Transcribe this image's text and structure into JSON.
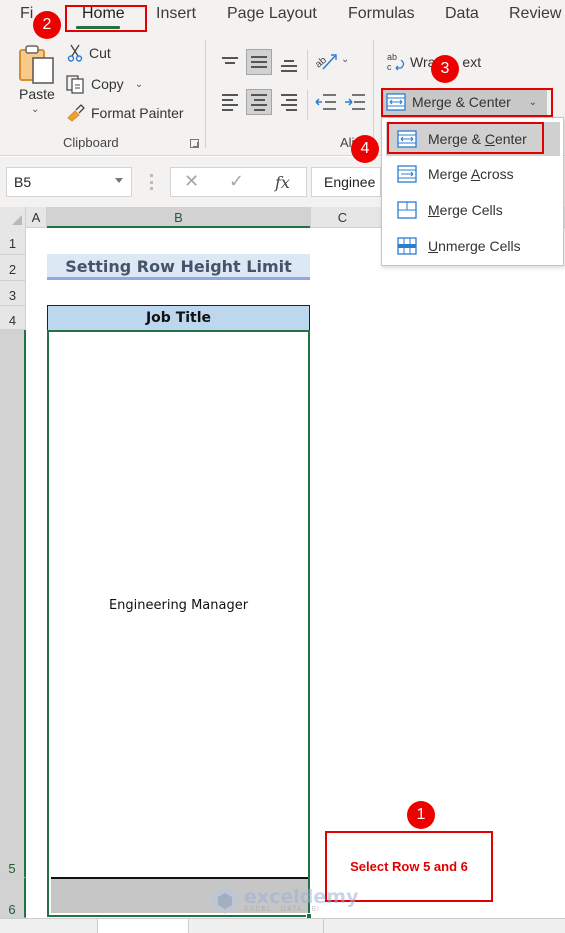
{
  "ribbon": {
    "tabs": [
      {
        "label": "File",
        "visible_text": "Fi"
      },
      {
        "label": "Home",
        "active": true
      },
      {
        "label": "Insert"
      },
      {
        "label": "Page Layout"
      },
      {
        "label": "Formulas"
      },
      {
        "label": "Data"
      },
      {
        "label": "Review"
      }
    ],
    "clipboard": {
      "paste_label": "Paste",
      "cut_label": "Cut",
      "copy_label": "Copy",
      "format_painter_label": "Format Painter",
      "group_label": "Clipboard"
    },
    "alignment": {
      "group_label": "Ali",
      "wrap_text_label": "Wrap Text",
      "wrap_text_visible": [
        "Wra",
        "ext"
      ],
      "merge_center_label": "Merge & Center"
    }
  },
  "merge_menu": {
    "items": [
      {
        "label_pre": "Merge & ",
        "accel": "C",
        "label_post": "enter",
        "icon": "merge-center-icon",
        "selected": true
      },
      {
        "label_pre": "Merge ",
        "accel": "A",
        "label_post": "cross",
        "icon": "merge-across-icon",
        "selected": false
      },
      {
        "label_pre": "",
        "accel": "M",
        "label_post": "erge Cells",
        "icon": "merge-cells-icon",
        "selected": false
      },
      {
        "label_pre": "",
        "accel": "U",
        "label_post": "nmerge Cells",
        "icon": "unmerge-cells-icon",
        "selected": false
      }
    ]
  },
  "formula_bar": {
    "name_box": "B5",
    "cancel_icon": "✕",
    "enter_icon": "✓",
    "fx_label": "fx",
    "content": "Engineering Manager",
    "content_visible": "Enginee"
  },
  "grid": {
    "columns": [
      "A",
      "B",
      "C"
    ],
    "rows": [
      "1",
      "2",
      "3",
      "4",
      "5",
      "6"
    ],
    "title": "Setting Row Height Limit",
    "header": "Job Title",
    "merged_value": "Engineering Manager"
  },
  "annotations": {
    "steps": [
      "1",
      "2",
      "3",
      "4"
    ],
    "callout": "Select Row 5 and 6"
  },
  "watermark": {
    "brand": "exceldemy",
    "tagline": "EXCEL · DATA · BI"
  },
  "colors": {
    "excel_green": "#217346",
    "highlight_red": "#e30000",
    "title_fill": "#dce9f5",
    "header_fill": "#bdd7ee"
  }
}
